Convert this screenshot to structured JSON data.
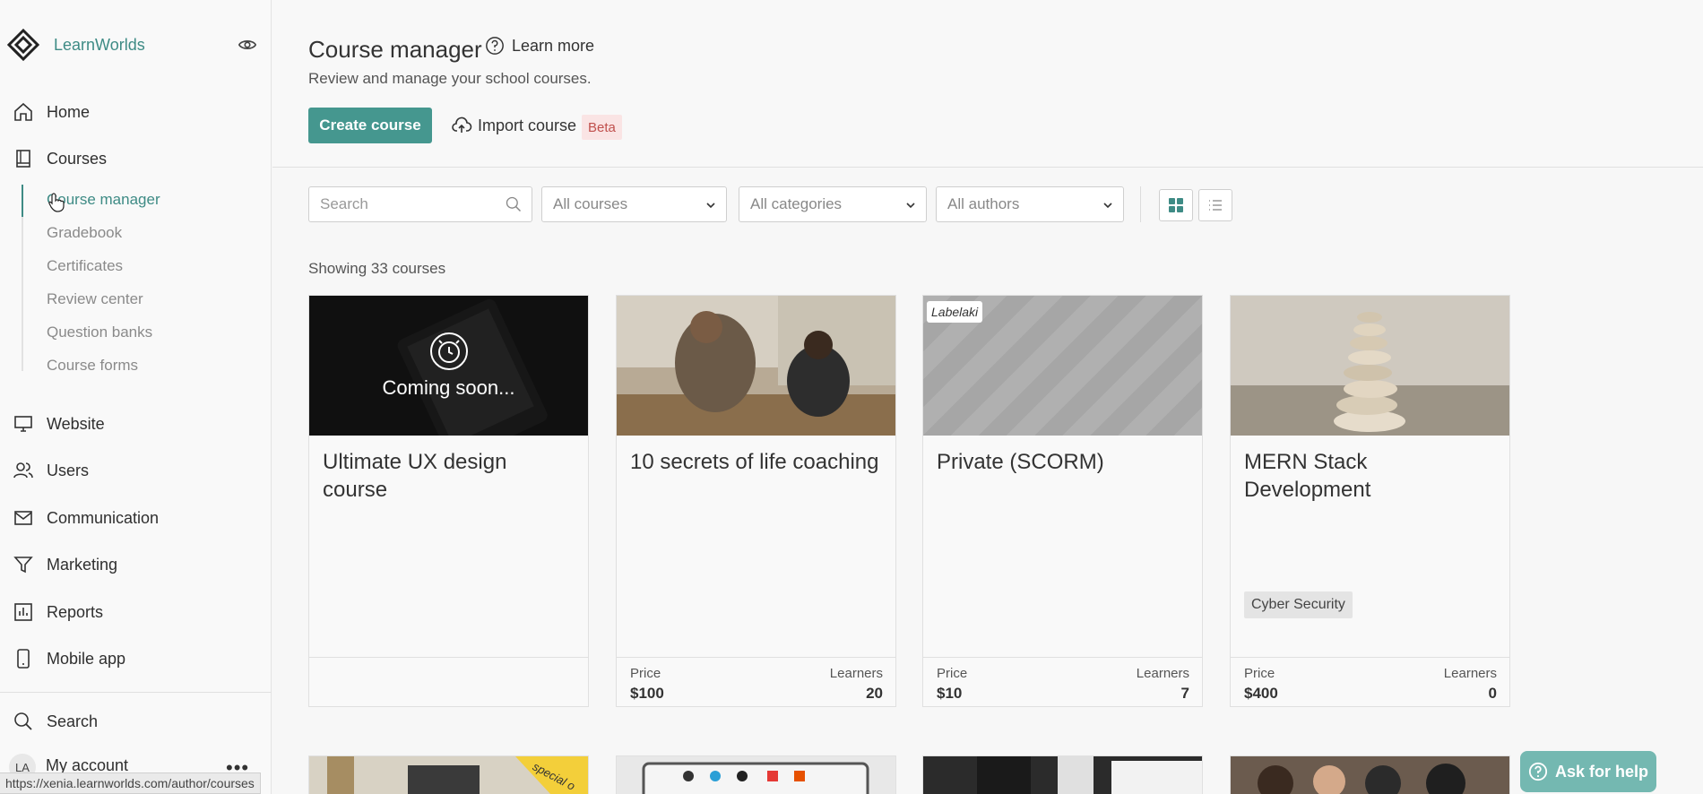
{
  "app": {
    "brand": "LearnWorlds"
  },
  "sidebar": {
    "nav": [
      {
        "label": "Home",
        "icon": "home-icon"
      },
      {
        "label": "Courses",
        "icon": "book-icon"
      },
      {
        "label": "Website",
        "icon": "monitor-icon"
      },
      {
        "label": "Users",
        "icon": "users-icon"
      },
      {
        "label": "Communication",
        "icon": "mail-icon"
      },
      {
        "label": "Marketing",
        "icon": "funnel-icon"
      },
      {
        "label": "Reports",
        "icon": "bar-chart-icon"
      },
      {
        "label": "Mobile app",
        "icon": "phone-icon"
      }
    ],
    "subnav": [
      {
        "label": "Course manager",
        "active": true
      },
      {
        "label": "Gradebook"
      },
      {
        "label": "Certificates"
      },
      {
        "label": "Review center"
      },
      {
        "label": "Question banks"
      },
      {
        "label": "Course forms"
      }
    ],
    "search_label": "Search",
    "account": {
      "initials": "LA",
      "label": "My account",
      "more": "•••"
    }
  },
  "header": {
    "title": "Course manager",
    "learn_more": "Learn more",
    "subtitle": "Review and manage your school courses.",
    "create_button": "Create course",
    "import_button": "Import course",
    "beta_badge": "Beta"
  },
  "filters": {
    "search_placeholder": "Search",
    "courses_select": "All courses",
    "categories_select": "All categories",
    "authors_select": "All authors"
  },
  "showing": "Showing 33 courses",
  "cards": [
    {
      "title": "Ultimate UX design course",
      "coming_soon": "Coming soon...",
      "price_label": "",
      "price": "",
      "learners_label": "",
      "learners": ""
    },
    {
      "title": "10 secrets of life coaching",
      "price_label": "Price",
      "price": "$100",
      "learners_label": "Learners",
      "learners": "20"
    },
    {
      "title": "Private (SCORM)",
      "label": "Labelaki",
      "price_label": "Price",
      "price": "$10",
      "learners_label": "Learners",
      "learners": "7"
    },
    {
      "title": "MERN Stack Development",
      "tag": "Cyber Security",
      "price_label": "Price",
      "price": "$400",
      "learners_label": "Learners",
      "learners": "0"
    }
  ],
  "second_row_badge": "special o",
  "help_button": "Ask for help",
  "status_url": "https://xenia.learnworlds.com/author/courses",
  "colors": {
    "accent": "#45978f",
    "help": "#74b8b1",
    "beta_bg": "#fae4e4",
    "beta_text": "#c0504d"
  }
}
